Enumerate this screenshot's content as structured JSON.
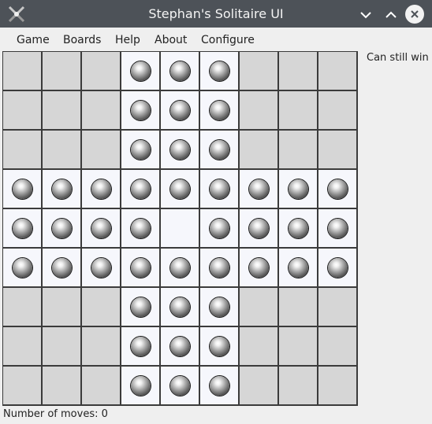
{
  "window": {
    "title": "Stephan's Solitaire UI",
    "buttons": {
      "minimize": "chevron-down-icon",
      "maximize": "chevron-up-icon",
      "close": "close-icon"
    }
  },
  "menu": [
    "Game",
    "Boards",
    "Help",
    "About",
    "Configure"
  ],
  "status": {
    "message": "Can still win",
    "moves_label": "Number of moves: 0"
  },
  "board": {
    "rows": [
      "...ooo...",
      "...ooo...",
      "...ooo...",
      "ooooooooo",
      "oooo.oooo",
      "ooooooooo",
      "...ooo...",
      "...ooo...",
      "...ooo..."
    ],
    "legend": {
      ".": "blocked-or-empty",
      "o": "peg"
    },
    "empty_hole": {
      "row": 4,
      "col": 4
    }
  },
  "colors": {
    "titlebar": "#4d5258",
    "menubar": "#efefef",
    "blocked_cell": "#d6d6d6",
    "playable_cell": "#f6f7fc",
    "grid_lines": "#3b3b3b"
  }
}
